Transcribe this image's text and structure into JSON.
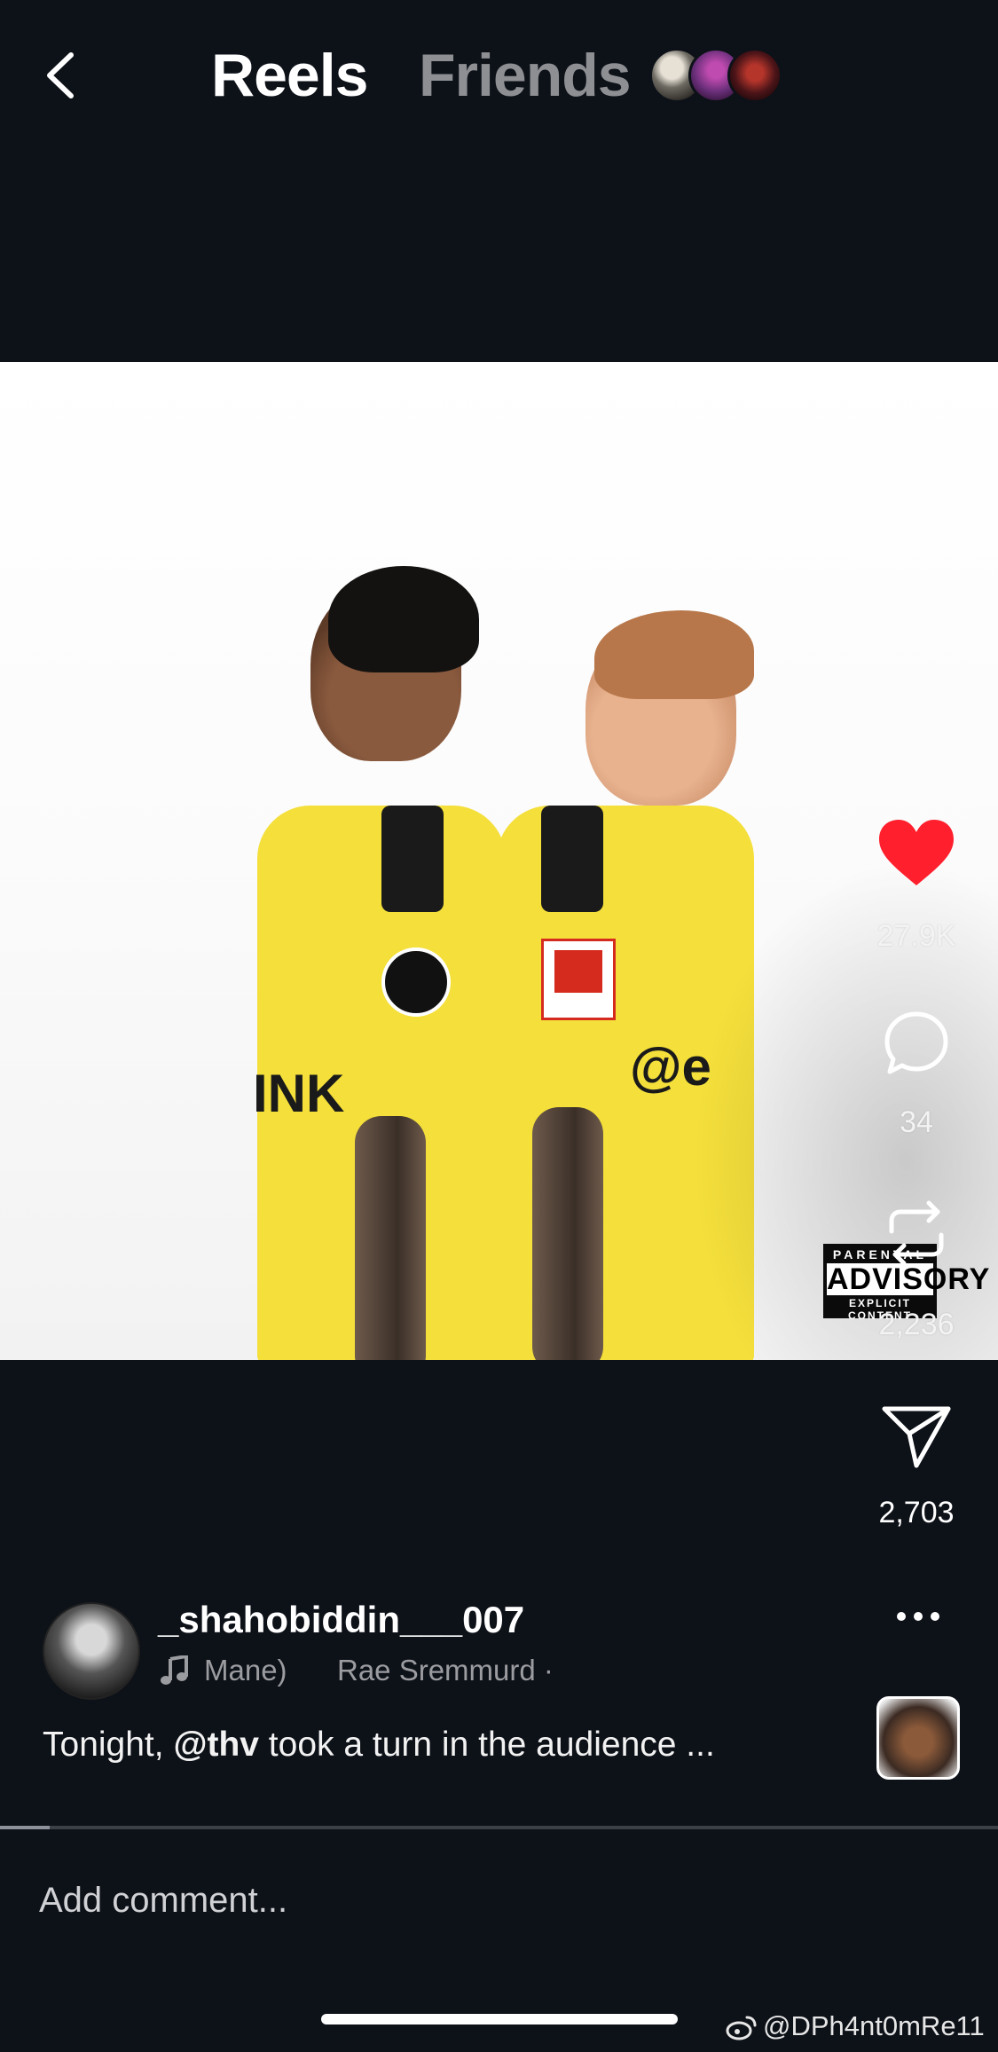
{
  "header": {
    "back_icon": "chevron-left-icon",
    "tabs": [
      {
        "label": "Reels",
        "active": true
      },
      {
        "label": "Friends",
        "active": false
      }
    ]
  },
  "media": {
    "advisory": {
      "line1": "PARENTAL",
      "line2": "ADVISORY",
      "line3": "EXPLICIT CONTENT"
    }
  },
  "actions": {
    "like": {
      "icon": "heart-icon",
      "count": "27.9K",
      "color": "#ff1f2d"
    },
    "comment": {
      "icon": "comment-bubble-icon",
      "count": "34"
    },
    "remix": {
      "icon": "repost-icon",
      "count": "2,236"
    },
    "share": {
      "icon": "send-icon",
      "count": "2,703"
    }
  },
  "post": {
    "username": "_shahobiddin___007",
    "music": {
      "song": "Mane)",
      "artist": "Rae Sremmurd ·"
    },
    "caption": {
      "before": "Tonight, ",
      "mention": "@thv",
      "after": " took a turn in the audience ..."
    },
    "more_icon": "more-horizontal-icon",
    "progress": 0.05
  },
  "comment_box": {
    "placeholder": "Add comment..."
  },
  "watermark": "@DPh4nt0mRe11"
}
